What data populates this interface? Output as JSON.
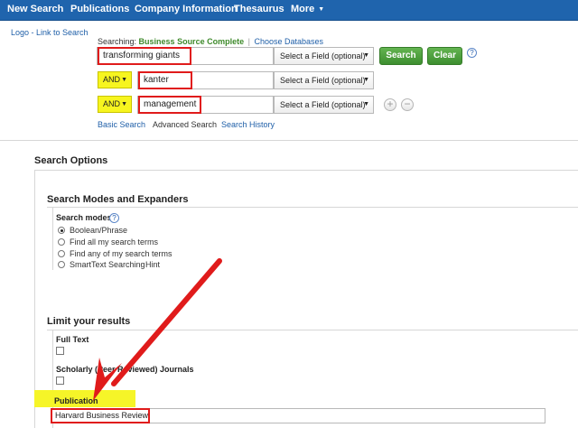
{
  "nav": {
    "items": [
      "New Search",
      "Publications",
      "Company Information",
      "Thesaurus",
      "More"
    ]
  },
  "logo_link": "Logo - Link to Search",
  "searching": {
    "prefix": "Searching:",
    "database": "Business Source Complete",
    "separator": "|",
    "choose_link": "Choose Databases"
  },
  "rows": [
    {
      "bool": "",
      "term": "transforming giants",
      "field": "Select a Field (optional)"
    },
    {
      "bool": "AND",
      "term": "kanter",
      "field": "Select a Field (optional)"
    },
    {
      "bool": "AND",
      "term": "management",
      "field": "Select a Field (optional)"
    }
  ],
  "buttons": {
    "search": "Search",
    "clear": "Clear"
  },
  "help_glyph": "?",
  "add_glyph": "+",
  "remove_glyph": "−",
  "search_links": {
    "basic": "Basic Search",
    "advanced": "Advanced Search",
    "history": "Search History"
  },
  "options": {
    "title": "Search Options",
    "modes_title": "Search Modes and Expanders",
    "modes_label": "Search modes",
    "modes": [
      "Boolean/Phrase",
      "Find all my search terms",
      "Find any of my search terms",
      "SmartText Searching"
    ],
    "selected_mode": 0,
    "hint": "Hint"
  },
  "limits": {
    "title": "Limit your results",
    "full_text": "Full Text",
    "scholarly": "Scholarly (Peer Reviewed) Journals",
    "publication_label": "Publication",
    "publication_value": "Harvard Business Review"
  },
  "colors": {
    "nav_bg": "#1f64ad",
    "green_button": "#4a9e3a",
    "highlight_yellow": "#f6f528",
    "annotation_red": "#e01b1b",
    "link_blue": "#1f5fa8"
  }
}
